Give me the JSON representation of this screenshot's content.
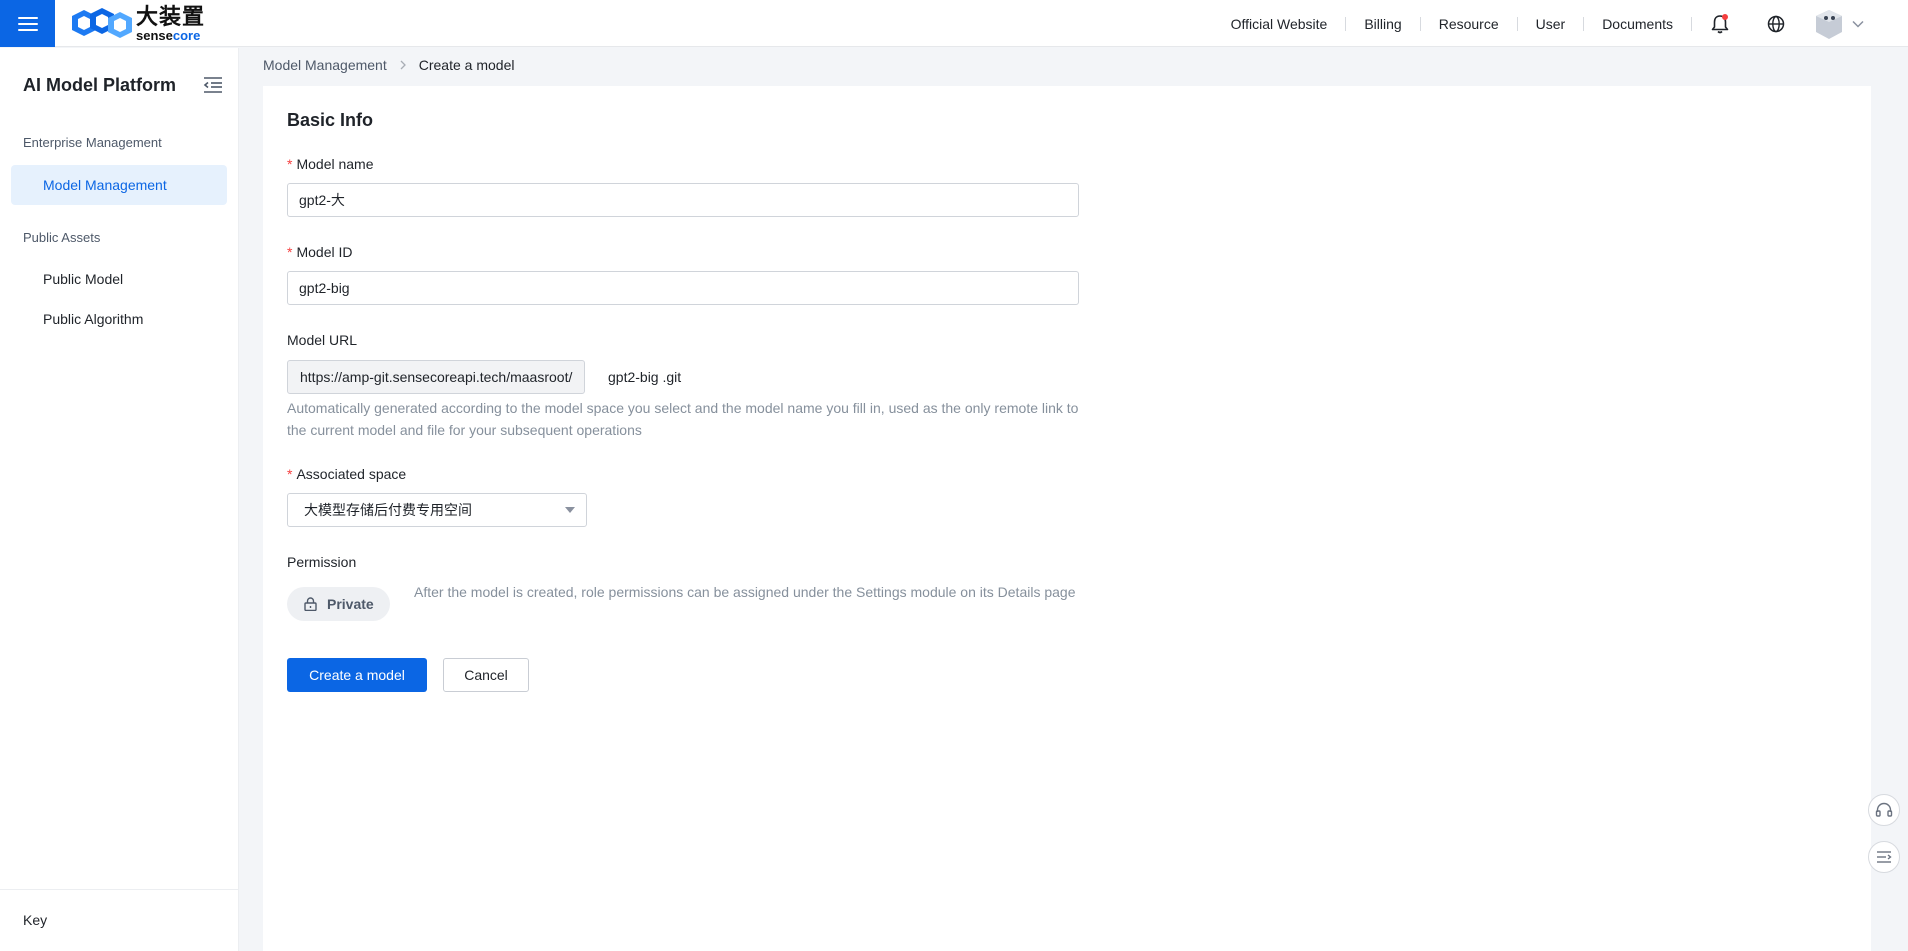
{
  "header": {
    "logo_cn": "大装置",
    "logo_en_prefix": "sense",
    "logo_en_suffix": "core",
    "nav": [
      "Official Website",
      "Billing",
      "Resource",
      "User",
      "Documents"
    ]
  },
  "sidebar": {
    "title": "AI Model Platform",
    "groups": [
      {
        "label": "Enterprise Management",
        "items": [
          {
            "label": "Model Management",
            "active": true
          }
        ]
      },
      {
        "label": "Public Assets",
        "items": [
          {
            "label": "Public Model"
          },
          {
            "label": "Public Algorithm"
          }
        ]
      }
    ],
    "footer_label": "Key"
  },
  "breadcrumb": {
    "parent": "Model Management",
    "current": "Create a model"
  },
  "form": {
    "section_title": "Basic Info",
    "model_name": {
      "label": "Model name",
      "value": "gpt2-大"
    },
    "model_id": {
      "label": "Model ID",
      "value": "gpt2-big"
    },
    "model_url": {
      "label": "Model URL",
      "prefix": "https://amp-git.sensecoreapi.tech/maasroot/",
      "suffix": "gpt2-big .git",
      "hint": "Automatically generated according to the model space you select and the model name you fill in, used as the only remote link to the current model and file for your subsequent operations"
    },
    "associated_space": {
      "label": "Associated space",
      "value": "大模型存储后付费专用空间"
    },
    "permission": {
      "label": "Permission",
      "value": "Private",
      "hint": "After the model is created, role permissions can be assigned under the Settings module on its Details page"
    },
    "submit_label": "Create a model",
    "cancel_label": "Cancel"
  },
  "colors": {
    "accent": "#0b66e4",
    "required": "#f53f3f",
    "active_bg": "#e6f1fd"
  }
}
